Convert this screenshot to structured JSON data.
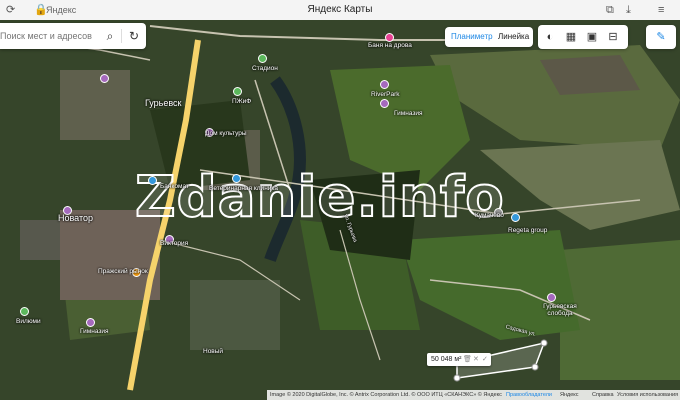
{
  "browser": {
    "window_title": "Яндекс Карты",
    "site": "Яндекс"
  },
  "search": {
    "placeholder": "Поиск мест и адресов"
  },
  "controls": {
    "layer_label": "Планиметр",
    "ruler_label": "Линейка"
  },
  "map_labels": {
    "gurevsk": "Гурьевск",
    "novator": "Новатор",
    "kumachevo": "Кумачёво",
    "stadion": "Стадион",
    "riverpark": "RiverPark",
    "gimnaziya": "Гимназия",
    "viktoria": "Виктория",
    "bankomat": "Банкомат",
    "pozharny": "Пражский рынок",
    "vilyumi": "Вилюми",
    "gurevskaya_sloboda": "Гурьевская слобода",
    "regeta": "Regeta group",
    "bankdom": "Баня на дрова",
    "novy": "Новый",
    "gimnaziya2": "Гимназия",
    "kulture": "Дом культуры",
    "pervomay": "Ветеринарная клиника",
    "pushka": "ПЖиФ",
    "street1": "ул. Гурьева",
    "street2": "Садовая ул."
  },
  "watermark": "Zdanie.info",
  "measurement": {
    "area": "50 048 м²"
  },
  "footer": {
    "copyright": "Image © 2020 DigitalGlobe, Inc. © Antrix Corporation Ltd. © ООО ИТЦ «СКАНЭКС» © Яндекс",
    "rights": "Правообладатели",
    "yandex": "Яндекс",
    "help": "Справка",
    "terms": "Условия использования"
  },
  "colors": {
    "accent": "#1e88e5",
    "road": "#f6d36b",
    "field": "#3f5e2a"
  }
}
